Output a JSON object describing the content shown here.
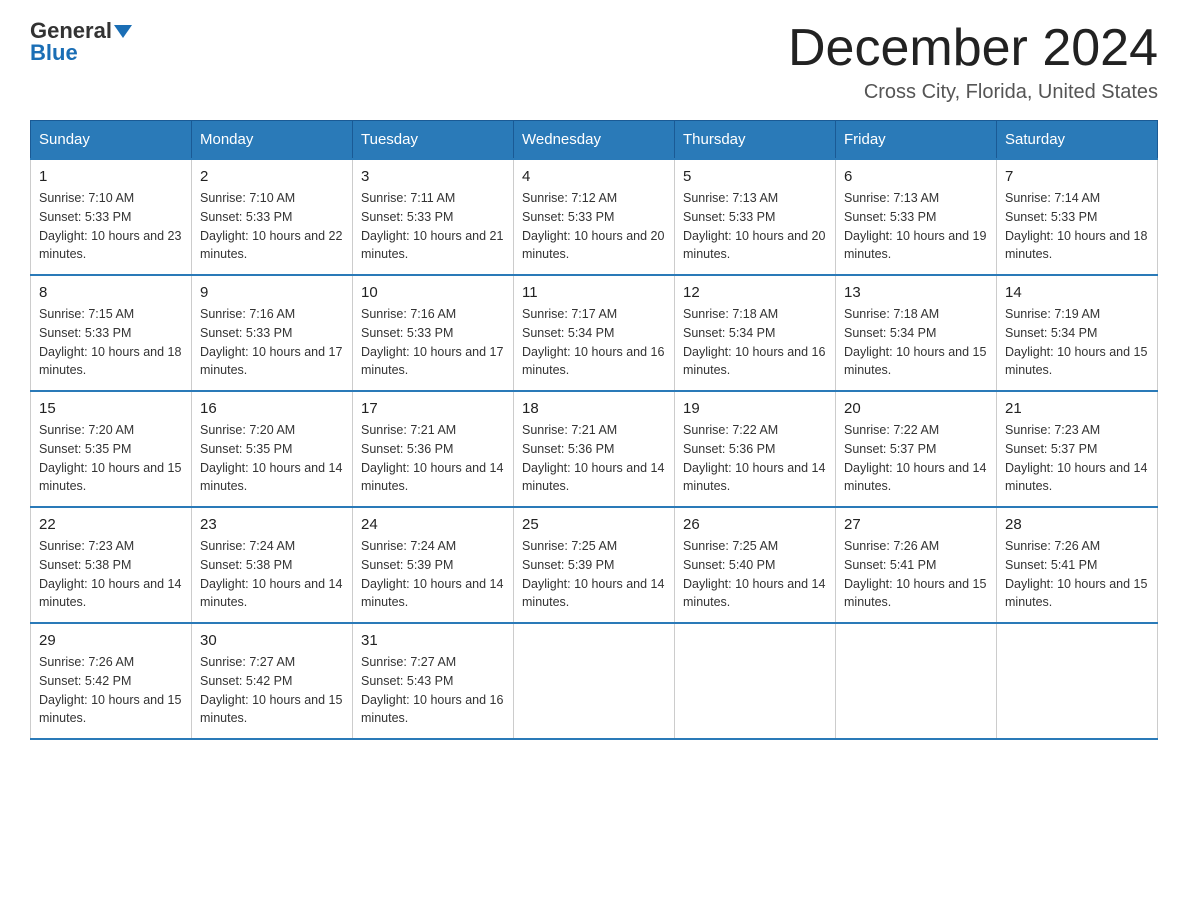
{
  "header": {
    "logo_line1": "General",
    "logo_arrow": true,
    "logo_line2": "Blue",
    "month_title": "December 2024",
    "location": "Cross City, Florida, United States"
  },
  "weekdays": [
    "Sunday",
    "Monday",
    "Tuesday",
    "Wednesday",
    "Thursday",
    "Friday",
    "Saturday"
  ],
  "weeks": [
    [
      {
        "day": "1",
        "sunrise": "7:10 AM",
        "sunset": "5:33 PM",
        "daylight": "10 hours and 23 minutes."
      },
      {
        "day": "2",
        "sunrise": "7:10 AM",
        "sunset": "5:33 PM",
        "daylight": "10 hours and 22 minutes."
      },
      {
        "day": "3",
        "sunrise": "7:11 AM",
        "sunset": "5:33 PM",
        "daylight": "10 hours and 21 minutes."
      },
      {
        "day": "4",
        "sunrise": "7:12 AM",
        "sunset": "5:33 PM",
        "daylight": "10 hours and 20 minutes."
      },
      {
        "day": "5",
        "sunrise": "7:13 AM",
        "sunset": "5:33 PM",
        "daylight": "10 hours and 20 minutes."
      },
      {
        "day": "6",
        "sunrise": "7:13 AM",
        "sunset": "5:33 PM",
        "daylight": "10 hours and 19 minutes."
      },
      {
        "day": "7",
        "sunrise": "7:14 AM",
        "sunset": "5:33 PM",
        "daylight": "10 hours and 18 minutes."
      }
    ],
    [
      {
        "day": "8",
        "sunrise": "7:15 AM",
        "sunset": "5:33 PM",
        "daylight": "10 hours and 18 minutes."
      },
      {
        "day": "9",
        "sunrise": "7:16 AM",
        "sunset": "5:33 PM",
        "daylight": "10 hours and 17 minutes."
      },
      {
        "day": "10",
        "sunrise": "7:16 AM",
        "sunset": "5:33 PM",
        "daylight": "10 hours and 17 minutes."
      },
      {
        "day": "11",
        "sunrise": "7:17 AM",
        "sunset": "5:34 PM",
        "daylight": "10 hours and 16 minutes."
      },
      {
        "day": "12",
        "sunrise": "7:18 AM",
        "sunset": "5:34 PM",
        "daylight": "10 hours and 16 minutes."
      },
      {
        "day": "13",
        "sunrise": "7:18 AM",
        "sunset": "5:34 PM",
        "daylight": "10 hours and 15 minutes."
      },
      {
        "day": "14",
        "sunrise": "7:19 AM",
        "sunset": "5:34 PM",
        "daylight": "10 hours and 15 minutes."
      }
    ],
    [
      {
        "day": "15",
        "sunrise": "7:20 AM",
        "sunset": "5:35 PM",
        "daylight": "10 hours and 15 minutes."
      },
      {
        "day": "16",
        "sunrise": "7:20 AM",
        "sunset": "5:35 PM",
        "daylight": "10 hours and 14 minutes."
      },
      {
        "day": "17",
        "sunrise": "7:21 AM",
        "sunset": "5:36 PM",
        "daylight": "10 hours and 14 minutes."
      },
      {
        "day": "18",
        "sunrise": "7:21 AM",
        "sunset": "5:36 PM",
        "daylight": "10 hours and 14 minutes."
      },
      {
        "day": "19",
        "sunrise": "7:22 AM",
        "sunset": "5:36 PM",
        "daylight": "10 hours and 14 minutes."
      },
      {
        "day": "20",
        "sunrise": "7:22 AM",
        "sunset": "5:37 PM",
        "daylight": "10 hours and 14 minutes."
      },
      {
        "day": "21",
        "sunrise": "7:23 AM",
        "sunset": "5:37 PM",
        "daylight": "10 hours and 14 minutes."
      }
    ],
    [
      {
        "day": "22",
        "sunrise": "7:23 AM",
        "sunset": "5:38 PM",
        "daylight": "10 hours and 14 minutes."
      },
      {
        "day": "23",
        "sunrise": "7:24 AM",
        "sunset": "5:38 PM",
        "daylight": "10 hours and 14 minutes."
      },
      {
        "day": "24",
        "sunrise": "7:24 AM",
        "sunset": "5:39 PM",
        "daylight": "10 hours and 14 minutes."
      },
      {
        "day": "25",
        "sunrise": "7:25 AM",
        "sunset": "5:39 PM",
        "daylight": "10 hours and 14 minutes."
      },
      {
        "day": "26",
        "sunrise": "7:25 AM",
        "sunset": "5:40 PM",
        "daylight": "10 hours and 14 minutes."
      },
      {
        "day": "27",
        "sunrise": "7:26 AM",
        "sunset": "5:41 PM",
        "daylight": "10 hours and 15 minutes."
      },
      {
        "day": "28",
        "sunrise": "7:26 AM",
        "sunset": "5:41 PM",
        "daylight": "10 hours and 15 minutes."
      }
    ],
    [
      {
        "day": "29",
        "sunrise": "7:26 AM",
        "sunset": "5:42 PM",
        "daylight": "10 hours and 15 minutes."
      },
      {
        "day": "30",
        "sunrise": "7:27 AM",
        "sunset": "5:42 PM",
        "daylight": "10 hours and 15 minutes."
      },
      {
        "day": "31",
        "sunrise": "7:27 AM",
        "sunset": "5:43 PM",
        "daylight": "10 hours and 16 minutes."
      },
      null,
      null,
      null,
      null
    ]
  ]
}
